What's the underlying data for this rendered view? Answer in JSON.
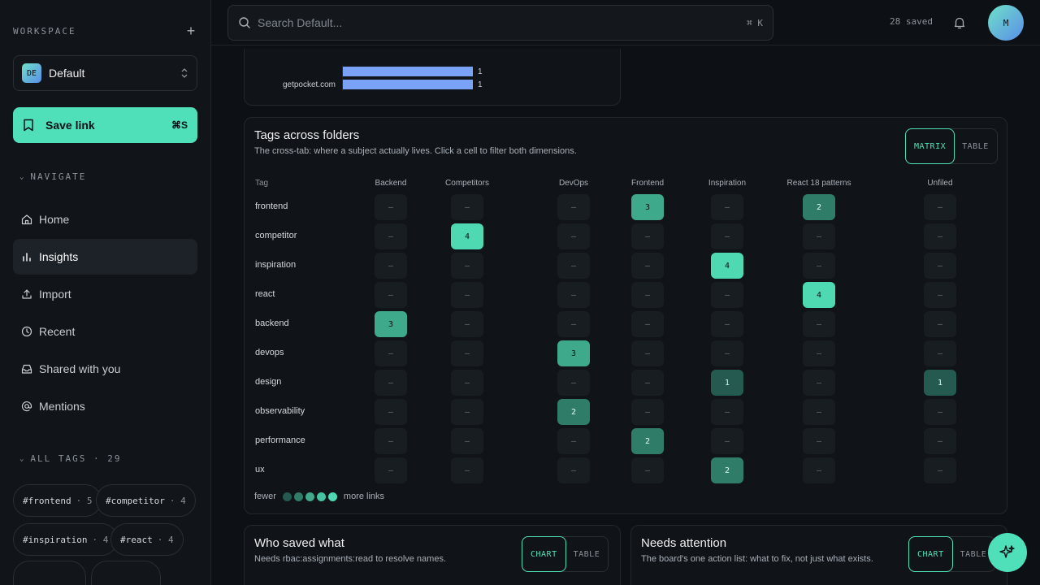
{
  "sidebar": {
    "workspace_label": "WORKSPACE",
    "workspace": {
      "badge": "DE",
      "name": "Default"
    },
    "save_button": {
      "label": "Save link",
      "shortcut": "⌘S"
    },
    "navigate_label": "NAVIGATE",
    "nav_items": [
      {
        "label": "Home",
        "icon": "home-icon"
      },
      {
        "label": "Insights",
        "icon": "bar-chart-icon",
        "active": true
      },
      {
        "label": "Import",
        "icon": "upload-icon"
      },
      {
        "label": "Recent",
        "icon": "clock-icon"
      },
      {
        "label": "Shared with you",
        "icon": "inbox-icon"
      },
      {
        "label": "Mentions",
        "icon": "at-icon"
      }
    ],
    "tags_label": "ALL TAGS · 29",
    "tags": [
      {
        "name": "#frontend",
        "count": "· 5"
      },
      {
        "name": "#competitor",
        "count": "· 4"
      },
      {
        "name": "#inspiration",
        "count": "· 4"
      },
      {
        "name": "#react",
        "count": "· 4"
      }
    ]
  },
  "topbar": {
    "search_placeholder": "Search Default...",
    "search_shortcut": "⌘ K",
    "saved_count": "28 saved",
    "avatar_initial": "M"
  },
  "source_card": {
    "bars": [
      {
        "label": "",
        "value": 1
      },
      {
        "label": "getpocket.com",
        "value": 1
      }
    ]
  },
  "tags_card": {
    "title": "Tags across folders",
    "subtitle": "The cross-tab: where a subject actually lives. Click a cell to filter both dimensions.",
    "toggle": [
      "MATRIX",
      "TABLE"
    ],
    "tag_header": "Tag",
    "columns": [
      "Backend",
      "Competitors",
      "DevOps",
      "Frontend",
      "Inspiration",
      "React 18 patterns",
      "Unfiled"
    ],
    "rows": [
      {
        "tag": "frontend",
        "cells": [
          "–",
          "–",
          "–",
          "3",
          "–",
          "2",
          "–"
        ]
      },
      {
        "tag": "competitor",
        "cells": [
          "–",
          "4",
          "–",
          "–",
          "–",
          "–",
          "–"
        ]
      },
      {
        "tag": "inspiration",
        "cells": [
          "–",
          "–",
          "–",
          "–",
          "4",
          "–",
          "–"
        ]
      },
      {
        "tag": "react",
        "cells": [
          "–",
          "–",
          "–",
          "–",
          "–",
          "4",
          "–"
        ]
      },
      {
        "tag": "backend",
        "cells": [
          "3",
          "–",
          "–",
          "–",
          "–",
          "–",
          "–"
        ]
      },
      {
        "tag": "devops",
        "cells": [
          "–",
          "–",
          "3",
          "–",
          "–",
          "–",
          "–"
        ]
      },
      {
        "tag": "design",
        "cells": [
          "–",
          "–",
          "–",
          "–",
          "1",
          "–",
          "1"
        ]
      },
      {
        "tag": "observability",
        "cells": [
          "–",
          "–",
          "2",
          "–",
          "–",
          "–",
          "–"
        ]
      },
      {
        "tag": "performance",
        "cells": [
          "–",
          "–",
          "–",
          "2",
          "–",
          "–",
          "–"
        ]
      },
      {
        "tag": "ux",
        "cells": [
          "–",
          "–",
          "–",
          "–",
          "2",
          "–",
          "–"
        ]
      }
    ],
    "legend": {
      "low": "fewer",
      "high": "more links",
      "colors": [
        "#245a4f",
        "#2f7d69",
        "#3ea98b",
        "#45c3a0",
        "#4fd9b3"
      ]
    }
  },
  "who_card": {
    "title": "Who saved what",
    "subtitle": "Needs rbac:assignments:read to resolve names.",
    "toggle": [
      "CHART",
      "TABLE"
    ]
  },
  "attention_card": {
    "title": "Needs attention",
    "subtitle": "The board's one action list: what to fix, not just what exists.",
    "toggle": [
      "CHART",
      "TABLE"
    ]
  },
  "colors": {
    "accent": "#4fe0b9",
    "bar": "#7aa2f7"
  }
}
